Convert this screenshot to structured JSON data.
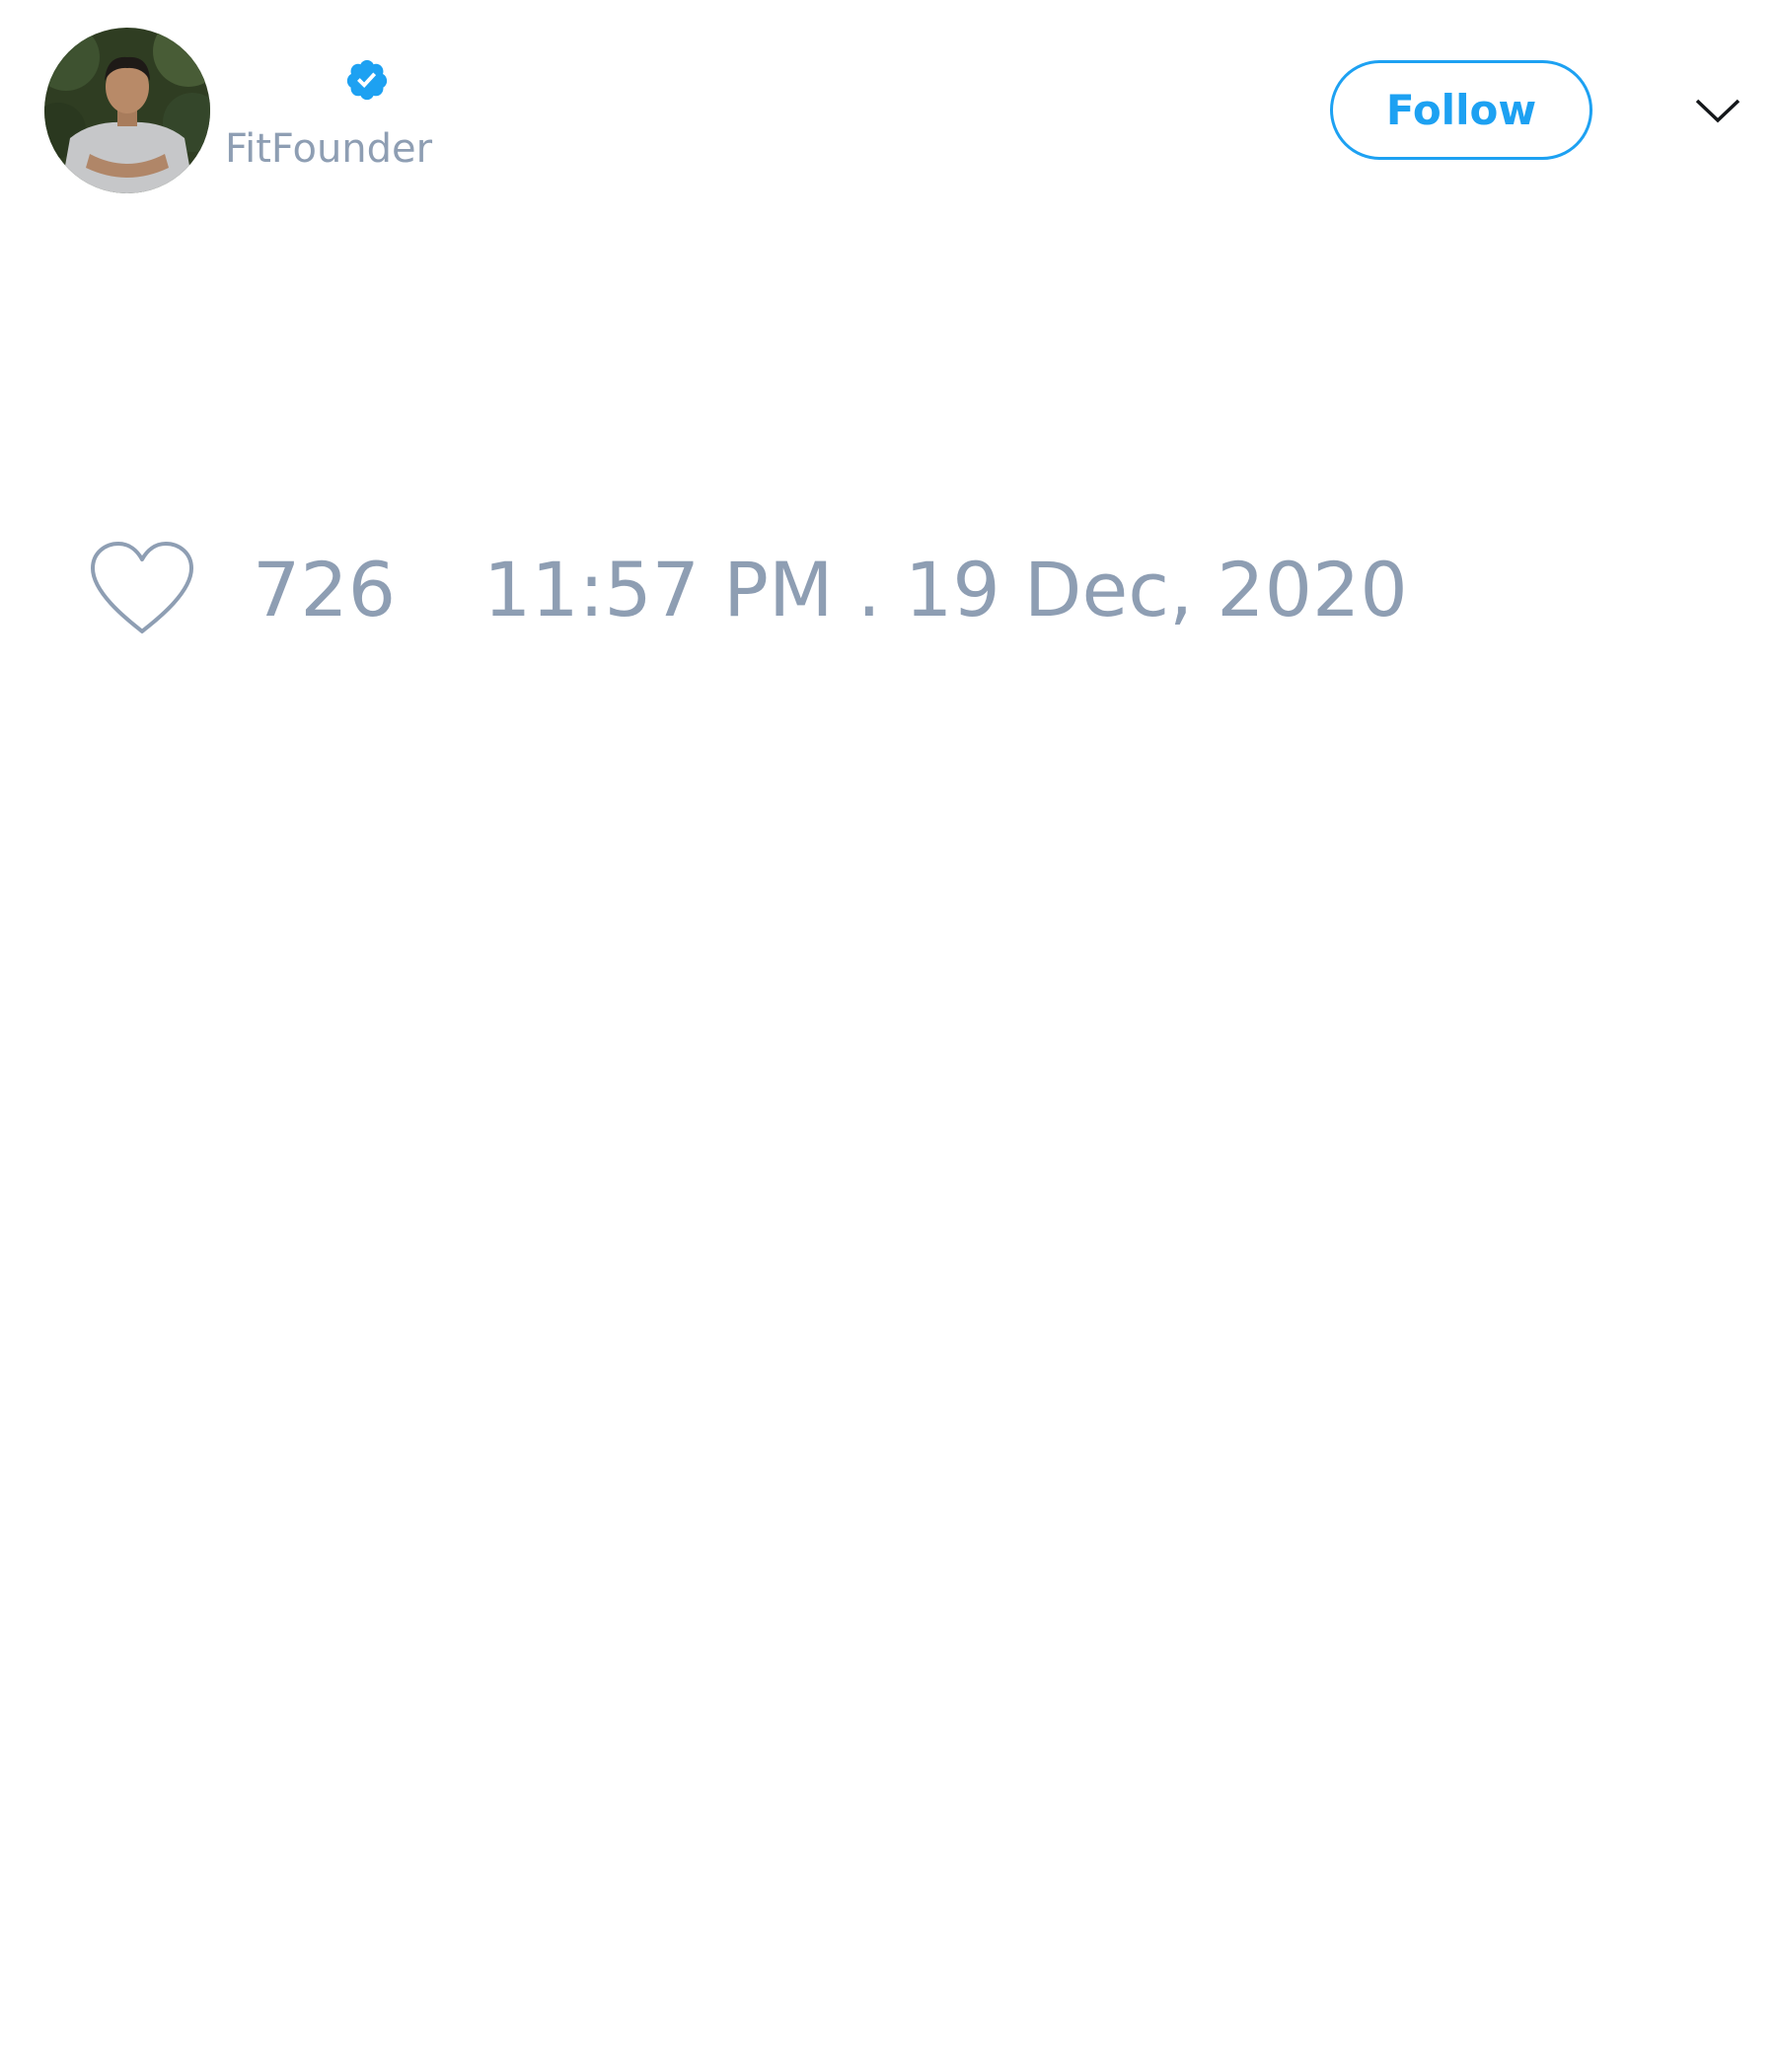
{
  "tweet": {
    "author": {
      "handle": "FitFounder",
      "verified": true,
      "avatar_icon": "profile-photo"
    },
    "follow_button": {
      "label": "Follow"
    },
    "menu_icon": "chevron-down-icon",
    "like_icon": "heart-icon",
    "likes": "726",
    "timestamp": "11:57 PM . 19 Dec, 2020"
  },
  "colors": {
    "accent": "#1da1f2",
    "muted_text": "#8e9eb3",
    "background": "#ffffff"
  }
}
